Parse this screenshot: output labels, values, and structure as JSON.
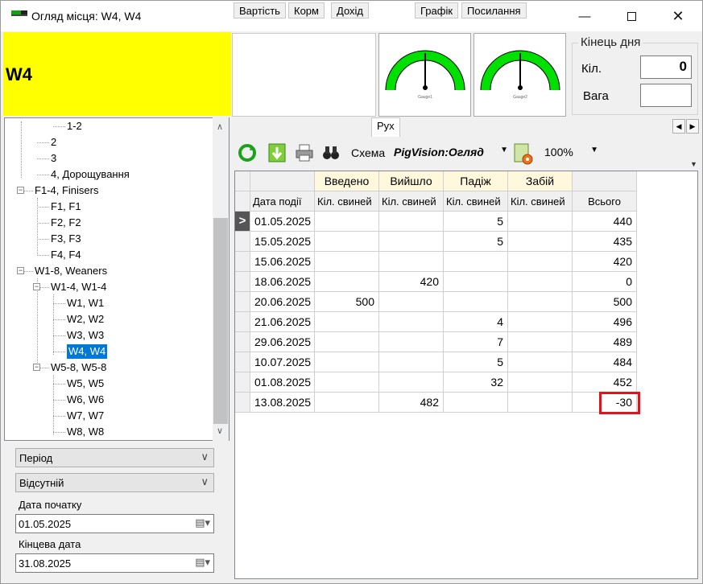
{
  "window": {
    "title": "Огляд місця: W4, W4",
    "icon": "app-icon",
    "controls": [
      "minimize-icon",
      "maximize-icon",
      "close-icon"
    ]
  },
  "header": {
    "place": "W4",
    "gauge1_label": "Gauge1",
    "gauge2_label": "Gauge2",
    "gauge_color": "#00e000"
  },
  "day_end": {
    "title": "Кінець дня",
    "qty_label": "Кіл.",
    "qty_value": "0",
    "weight_label": "Вага",
    "weight_value": ""
  },
  "tree": {
    "nodes": [
      {
        "label": "1-2",
        "level": 3
      },
      {
        "label": "2",
        "level": 2
      },
      {
        "label": "3",
        "level": 2
      },
      {
        "label": "4, Дорощування",
        "level": 2
      },
      {
        "label": "F1-4, Finisers",
        "level": 1,
        "expander": "−"
      },
      {
        "label": "F1, F1",
        "level": 2
      },
      {
        "label": "F2, F2",
        "level": 2
      },
      {
        "label": "F3, F3",
        "level": 2
      },
      {
        "label": "F4, F4",
        "level": 2
      },
      {
        "label": "W1-8, Weaners",
        "level": 1,
        "expander": "−"
      },
      {
        "label": "W1-4, W1-4",
        "level": 2,
        "expander": "−"
      },
      {
        "label": "W1, W1",
        "level": 3
      },
      {
        "label": "W2, W2",
        "level": 3
      },
      {
        "label": "W3, W3",
        "level": 3
      },
      {
        "label": "W4, W4",
        "level": 3,
        "selected": true
      },
      {
        "label": "W5-8, W5-8",
        "level": 2,
        "expander": "−"
      },
      {
        "label": "W5, W5",
        "level": 3
      },
      {
        "label": "W6, W6",
        "level": 3
      },
      {
        "label": "W7, W7",
        "level": 3
      },
      {
        "label": "W8, W8",
        "level": 3
      }
    ]
  },
  "filters": {
    "period": "Період",
    "absent": "Відсутній",
    "start_label": "Дата початку",
    "start_value": "01.05.2025",
    "end_label": "Кінцева дата",
    "end_value": "31.08.2025"
  },
  "tabs": [
    "Вартість",
    "Корм",
    "Дохід",
    "Рух",
    "Графік",
    "Посилання"
  ],
  "active_tab": "Рух",
  "toolbar": {
    "schema_label": "Схема",
    "schema_value": "PigVision:Огляд",
    "zoom": "100%",
    "icons": [
      "refresh-icon",
      "export-icon",
      "print-icon",
      "binoculars-icon",
      "report-settings-icon"
    ]
  },
  "grid": {
    "groups": [
      "Введено",
      "Вийшло",
      "Падіж",
      "Забій"
    ],
    "columns": [
      "Дата події",
      "Кіл. свиней",
      "Кіл. свиней",
      "Кіл. свиней",
      "Кіл. свиней",
      "Всього"
    ],
    "rows": [
      [
        "01.05.2025",
        "",
        "",
        "5",
        "",
        "440"
      ],
      [
        "15.05.2025",
        "",
        "",
        "5",
        "",
        "435"
      ],
      [
        "15.06.2025",
        "",
        "",
        "",
        "",
        "420"
      ],
      [
        "18.06.2025",
        "",
        "420",
        "",
        "",
        "0"
      ],
      [
        "20.06.2025",
        "500",
        "",
        "",
        "",
        "500"
      ],
      [
        "21.06.2025",
        "",
        "",
        "4",
        "",
        "496"
      ],
      [
        "29.06.2025",
        "",
        "",
        "7",
        "",
        "489"
      ],
      [
        "10.07.2025",
        "",
        "",
        "5",
        "",
        "484"
      ],
      [
        "01.08.2025",
        "",
        "",
        "32",
        "",
        "452"
      ],
      [
        "13.08.2025",
        "",
        "482",
        "",
        "",
        "-30"
      ]
    ],
    "current_row_marker": ">"
  }
}
